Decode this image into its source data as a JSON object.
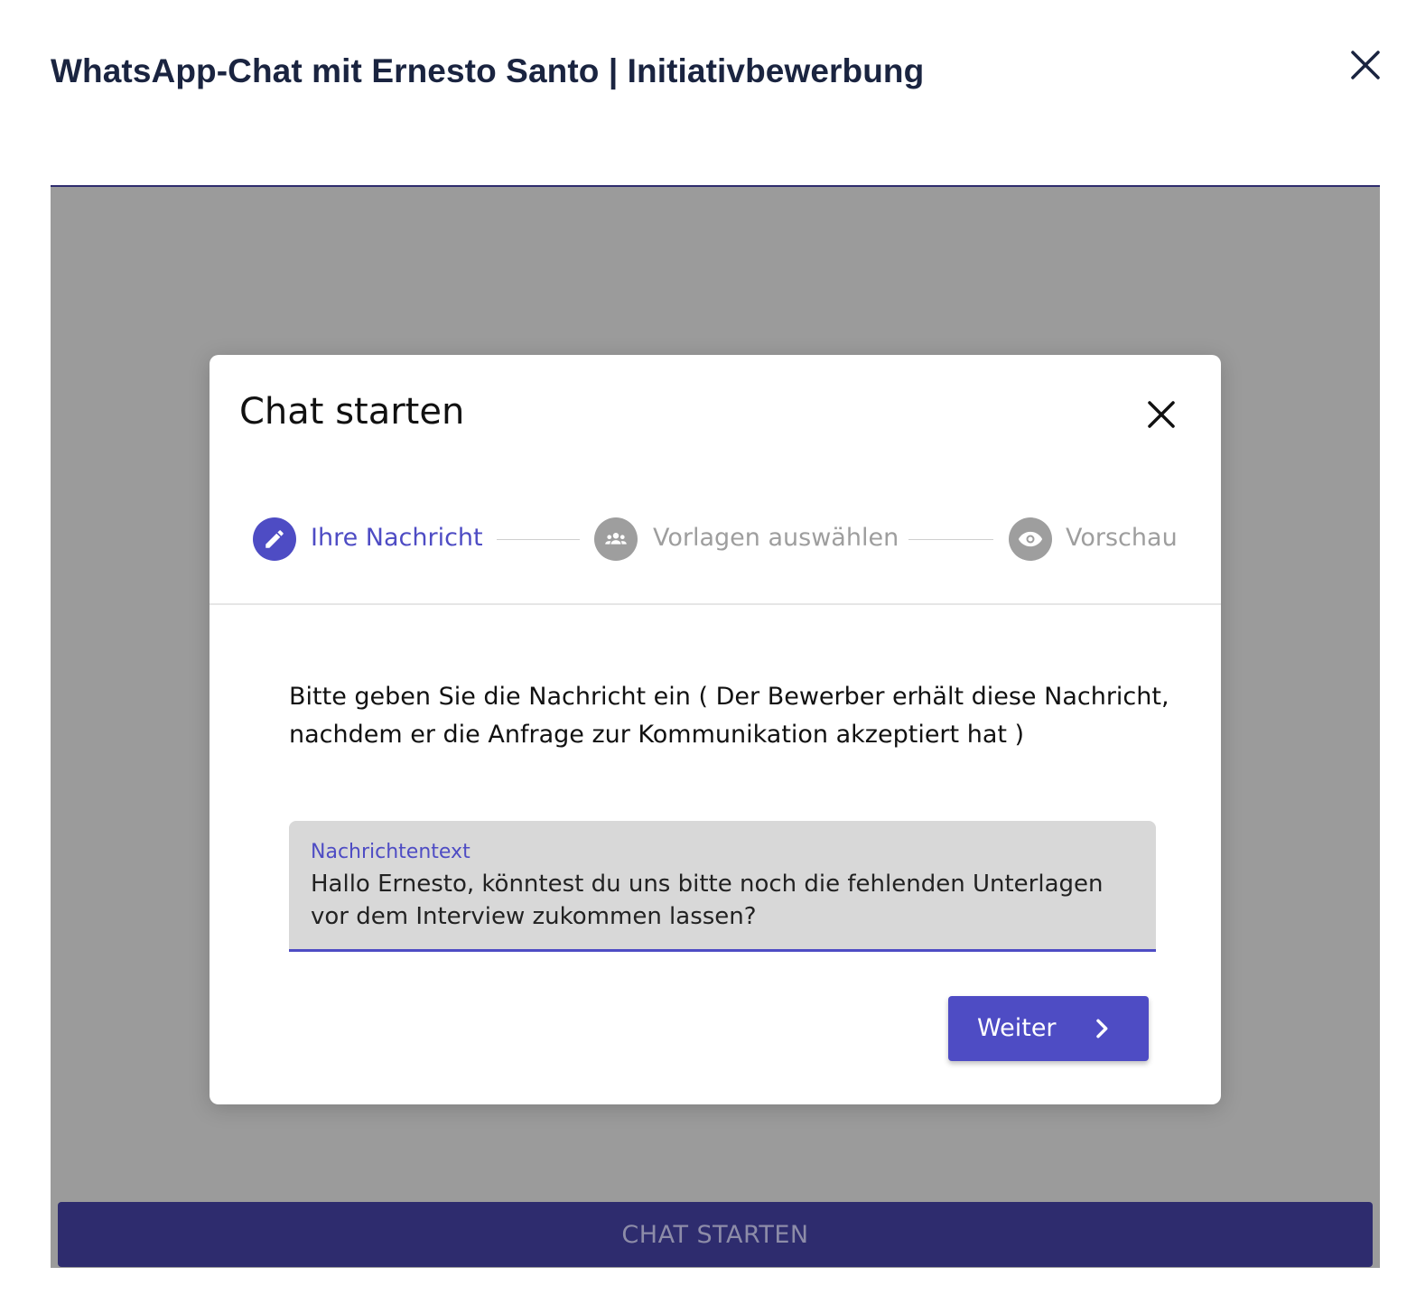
{
  "header": {
    "title": "WhatsApp-Chat mit Ernesto Santo | Initiativbewerbung",
    "close_icon": "close-icon"
  },
  "modal": {
    "title": "Chat starten",
    "close_icon": "close-icon",
    "steps": [
      {
        "label": "Ihre Nachricht",
        "icon": "pencil-icon",
        "state": "active"
      },
      {
        "label": "Vorlagen auswählen",
        "icon": "group-icon",
        "state": "inactive"
      },
      {
        "label": "Vorschau",
        "icon": "eye-icon",
        "state": "inactive"
      }
    ],
    "instruction": "Bitte geben Sie die Nachricht ein ( Der Bewerber erhält diese Nachricht, nachdem er die Anfrage zur Kommunikation akzeptiert hat )",
    "message_field": {
      "label": "Nachrichtentext",
      "value": "Hallo Ernesto, könntest du uns bitte noch die fehlenden Unterlagen vor dem Interview zukommen lassen?"
    },
    "next_button": {
      "label": "Weiter",
      "icon": "chevron-right-icon"
    }
  },
  "footer": {
    "start_chat_label": "CHAT STARTEN"
  },
  "colors": {
    "accent": "#4e4cc4",
    "header_text": "#1a2440",
    "footer_bar": "#2e2c6e",
    "overlay": "#9b9b9b",
    "inactive_step": "#9e9e9e"
  }
}
